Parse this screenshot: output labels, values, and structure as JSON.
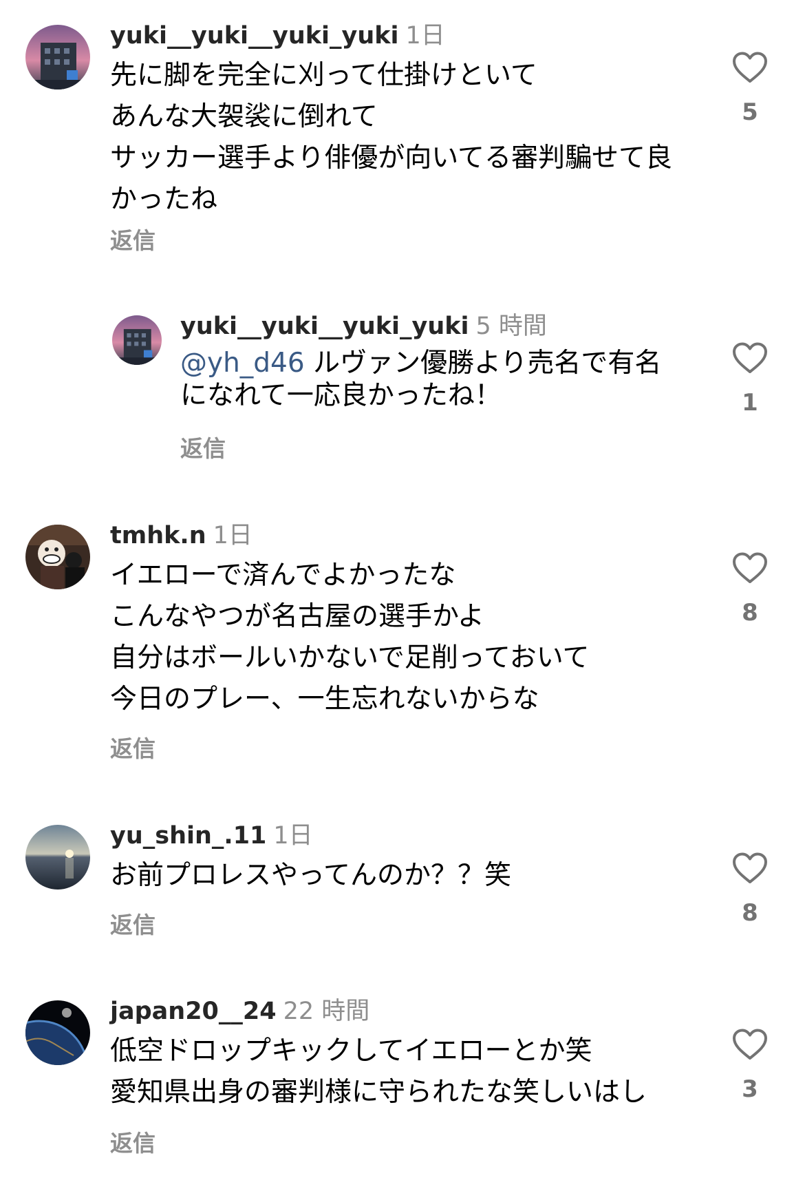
{
  "comments": [
    {
      "username": "yuki__yuki__yuki_yuki",
      "time": "1日",
      "lines": [
        "先に脚を完全に刈って仕掛けといて",
        "あんな大袈裟に倒れて",
        "サッカー選手より俳優が向いてる審判騙せて良",
        "かったね"
      ],
      "reply_label": "返信",
      "likes": "5",
      "avatar": "building-sunset-avatar"
    },
    {
      "username": "yuki__yuki__yuki_yuki",
      "time": "5 時間",
      "mention": "@yh_d46",
      "lines": [
        "ルヴァン優勝より売名で有名",
        "になれて一応良かったね！"
      ],
      "reply_label": "返信",
      "likes": "1",
      "avatar": "building-sunset-avatar"
    },
    {
      "username": "tmhk.n",
      "time": "1日",
      "lines": [
        "イエローで済んでよかったな",
        "こんなやつが名古屋の選手かよ",
        "自分はボールいかないで足削っておいて",
        "今日のプレー、一生忘れないからな"
      ],
      "reply_label": "返信",
      "likes": "8",
      "avatar": "mascot-avatar"
    },
    {
      "username": "yu_shin_.11",
      "time": "1日",
      "lines": [
        "お前プロレスやってんのか？？笑"
      ],
      "reply_label": "返信",
      "likes": "8",
      "avatar": "sea-sunset-avatar"
    },
    {
      "username": "japan20__24",
      "time": "22 時間",
      "lines": [
        "低空ドロップキックしてイエローとか笑",
        "愛知県出身の審判様に守られたな笑しいはし"
      ],
      "reply_label": "返信",
      "likes": "3",
      "avatar": "earth-space-avatar"
    }
  ],
  "colors": {
    "username": "#262626",
    "meta": "#8e8e8e",
    "mention": "#3a5a85",
    "like_count": "#737373"
  }
}
